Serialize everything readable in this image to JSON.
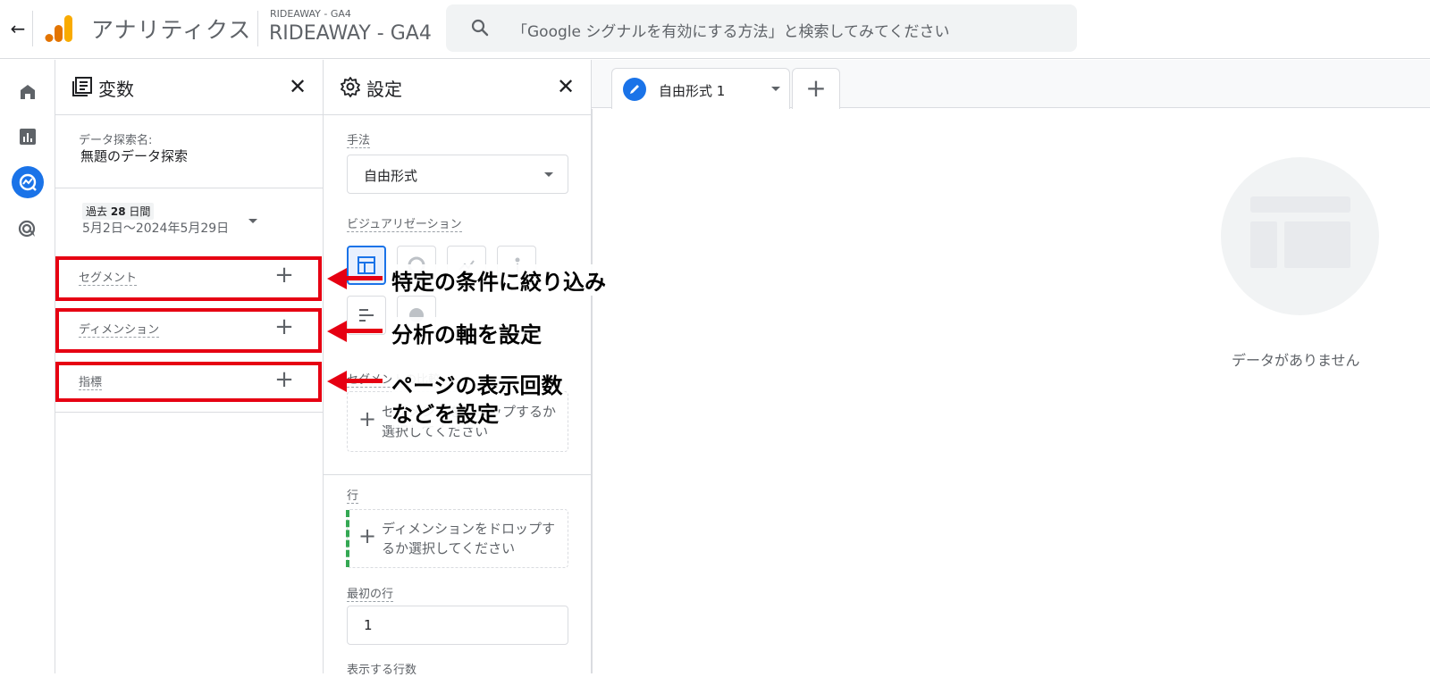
{
  "header": {
    "back_label": "←",
    "app_title": "アナリティクス",
    "account_small": "RIDEAWAY - GA4",
    "account_name": "RIDEAWAY - GA4",
    "search_placeholder": "「Google シグナルを有効にする方法」と検索してみてください"
  },
  "colors": {
    "accent": "#1a73e8",
    "annotation_red": "#e60012",
    "logo_orange": "#f9ab00",
    "logo_dark_orange": "#e37400",
    "row_green": "#34a853"
  },
  "rail": {
    "items": [
      {
        "icon": "home-icon"
      },
      {
        "icon": "reports-icon"
      },
      {
        "icon": "explore-icon"
      },
      {
        "icon": "advertising-icon"
      }
    ]
  },
  "variables": {
    "title": "変数",
    "close": "✕",
    "exploration_name_label": "データ探索名:",
    "exploration_name": "無題のデータ探索",
    "date_chip_prefix": "過去",
    "date_chip_number": "28",
    "date_chip_suffix": "日間",
    "date_range": "5月2日～2024年5月29日",
    "segments_label": "セグメント",
    "dimensions_label": "ディメンション",
    "metrics_label": "指標",
    "plus": "+"
  },
  "settings": {
    "title": "設定",
    "close": "✕",
    "technique_label": "手法",
    "technique_value": "自由形式",
    "visualization_label": "ビジュアリゼーション",
    "segment_compare_label": "セグメントの比較",
    "segment_drop_text": "セグメントをドロップするか選択してください",
    "rows_label": "行",
    "rows_drop_text": "ディメンションをドロップするか選択してください",
    "first_row_label": "最初の行",
    "first_row_value": "1",
    "rows_shown_label": "表示する行数",
    "plus": "+"
  },
  "tabs": {
    "active_label": "自由形式 1",
    "add": "+"
  },
  "canvas": {
    "empty_text": "データがありません"
  },
  "annotations": {
    "segment_note": "特定の条件に絞り込み",
    "dimension_note": "分析の軸を設定",
    "metric_note_line1": "ページの表示回数",
    "metric_note_line2": "などを設定"
  }
}
